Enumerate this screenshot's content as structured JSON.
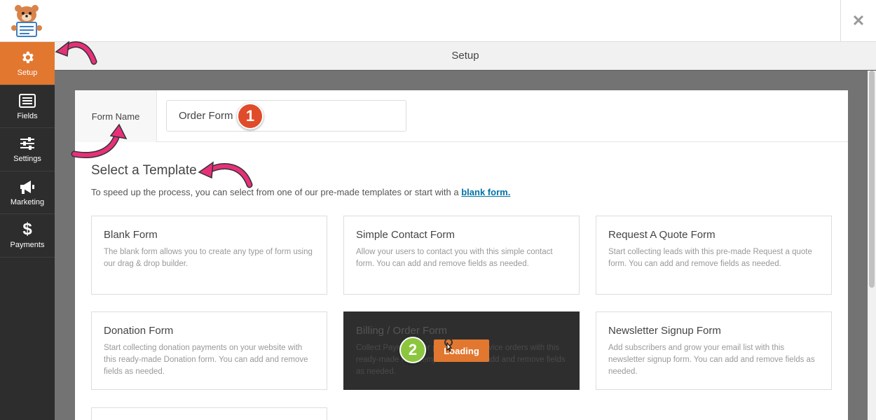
{
  "header": {
    "setup_title": "Setup"
  },
  "sidebar": {
    "items": [
      {
        "label": "Setup",
        "icon": "gear-icon",
        "active": true
      },
      {
        "label": "Fields",
        "icon": "fields-icon"
      },
      {
        "label": "Settings",
        "icon": "sliders-icon"
      },
      {
        "label": "Marketing",
        "icon": "megaphone-icon"
      },
      {
        "label": "Payments",
        "icon": "dollar-icon"
      }
    ]
  },
  "form": {
    "name_label": "Form Name",
    "name_value": "Order Form"
  },
  "templates": {
    "title": "Select a Template",
    "desc_prefix": "To speed up the process, you can select from one of our pre-made templates or start with a",
    "desc_link": "blank form.",
    "cards": [
      {
        "title": "Blank Form",
        "desc": "The blank form allows you to create any type of form using our drag & drop builder."
      },
      {
        "title": "Simple Contact Form",
        "desc": "Allow your users to contact you with this simple contact form. You can add and remove fields as needed."
      },
      {
        "title": "Request A Quote Form",
        "desc": "Start collecting leads with this pre-made Request a quote form. You can add and remove fields as needed."
      },
      {
        "title": "Donation Form",
        "desc": "Start collecting donation payments on your website with this ready-made Donation form. You can add and remove fields as needed."
      },
      {
        "title": "Billing / Order Form",
        "desc": "Collect Payments for product and service orders with this ready-made form template. You can add and remove fields as needed."
      },
      {
        "title": "Newsletter Signup Form",
        "desc": "Add subscribers and grow your email list with this newsletter signup form. You can add and remove fields as needed."
      }
    ],
    "loading_label": "Loading"
  },
  "steps": {
    "one": "1",
    "two": "2"
  },
  "colors": {
    "accent": "#e27730",
    "sidebar": "#2d2d2d",
    "link": "#0073aa",
    "annotation_arrow": "#e8307a",
    "step1": "#e04b2a",
    "step2": "#8cc63f"
  }
}
